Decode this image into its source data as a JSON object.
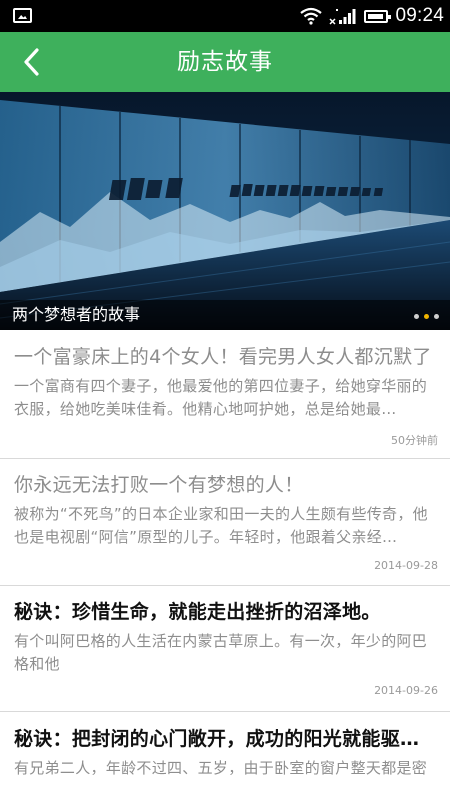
{
  "status_bar": {
    "time": "09:24",
    "icons": [
      "image-notification-icon",
      "wifi-icon",
      "signal-icon",
      "battery-icon"
    ]
  },
  "header": {
    "title": "励志故事",
    "back_icon": "chevron-left-icon",
    "background_color": "#3eb05c"
  },
  "banner": {
    "caption": "两个梦想者的故事",
    "slide_count": 3,
    "active_slide_index": 1,
    "active_dot_color": "#f0b400"
  },
  "articles": [
    {
      "title": "一个富豪床上的4个女人！看完男人女人都沉默了",
      "summary": "一个富商有四个妻子，他最爱他的第四位妻子，给她穿华丽的衣服，给她吃美味佳肴。他精心地呵护她，总是给她最…",
      "time": "50分钟前",
      "read": true
    },
    {
      "title": "你永远无法打败一个有梦想的人！",
      "summary": "被称为“不死鸟”的日本企业家和田一夫的人生颇有些传奇，他也是电视剧“阿信”原型的儿子。年轻时，他跟着父亲经…",
      "time": "2014-09-28",
      "read": true
    },
    {
      "title": "秘诀：珍惜生命，就能走出挫折的沼泽地。",
      "summary": "有个叫阿巴格的人生活在内蒙古草原上。有一次，年少的阿巴格和他",
      "time": "2014-09-26",
      "read": false
    },
    {
      "title": "秘诀：把封闭的心门敞开，成功的阳光就能驱…",
      "summary": "有兄弟二人，年龄不过四、五岁，由于卧室的窗户整天都是密",
      "time": "",
      "read": false
    }
  ]
}
